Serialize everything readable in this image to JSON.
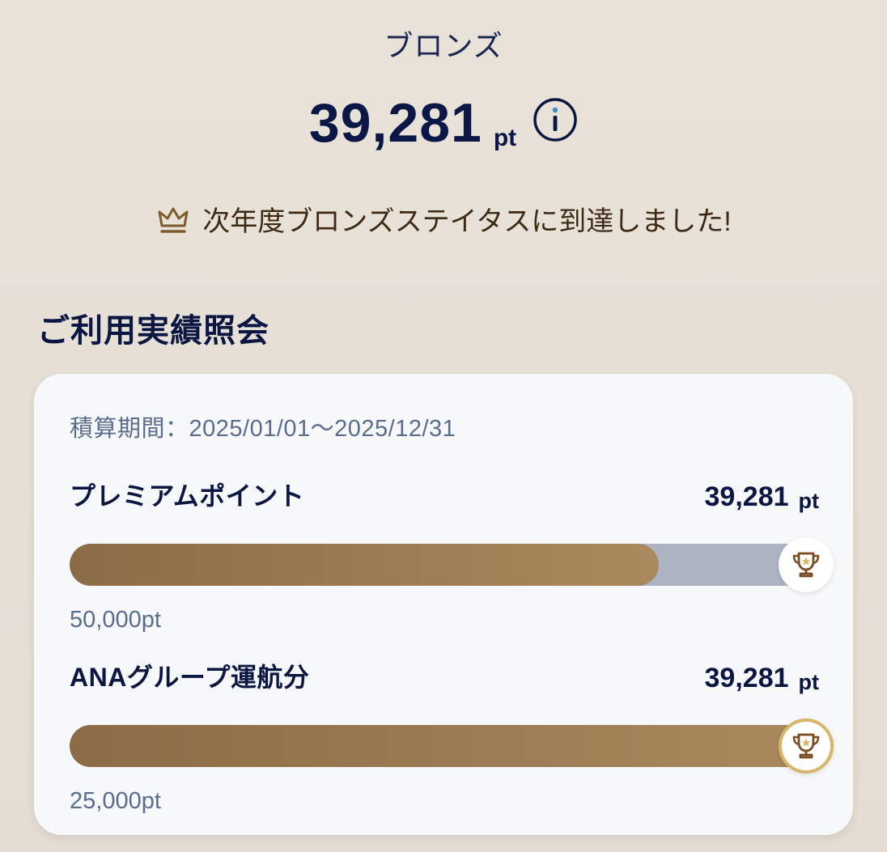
{
  "header": {
    "status_name": "ブロンズ",
    "points_value": "39,281",
    "points_unit": "pt",
    "next_status_message": "次年度ブロンズステイタスに到達しました!"
  },
  "section": {
    "title": "ご利用実績照会"
  },
  "card": {
    "period_label": "積算期間：2025/01/01〜2025/12/31",
    "metrics": [
      {
        "name": "プレミアムポイント",
        "value": "39,281",
        "unit": "pt",
        "target": "50,000pt",
        "progress": 0.786,
        "achieved": false
      },
      {
        "name": "ANAグループ運航分",
        "value": "39,281",
        "unit": "pt",
        "target": "25,000pt",
        "progress": 1.0,
        "achieved": true
      }
    ]
  },
  "colors": {
    "navy": "#0c1642",
    "bronze_start": "#8b6c46",
    "bronze_end": "#a98a5e",
    "track": "#aeb3c4",
    "muted_text": "#5a6d8e",
    "gold_ring": "#d8b56a"
  },
  "icons": {
    "info": "info-icon",
    "crown": "crown-icon",
    "trophy": "trophy-icon"
  }
}
